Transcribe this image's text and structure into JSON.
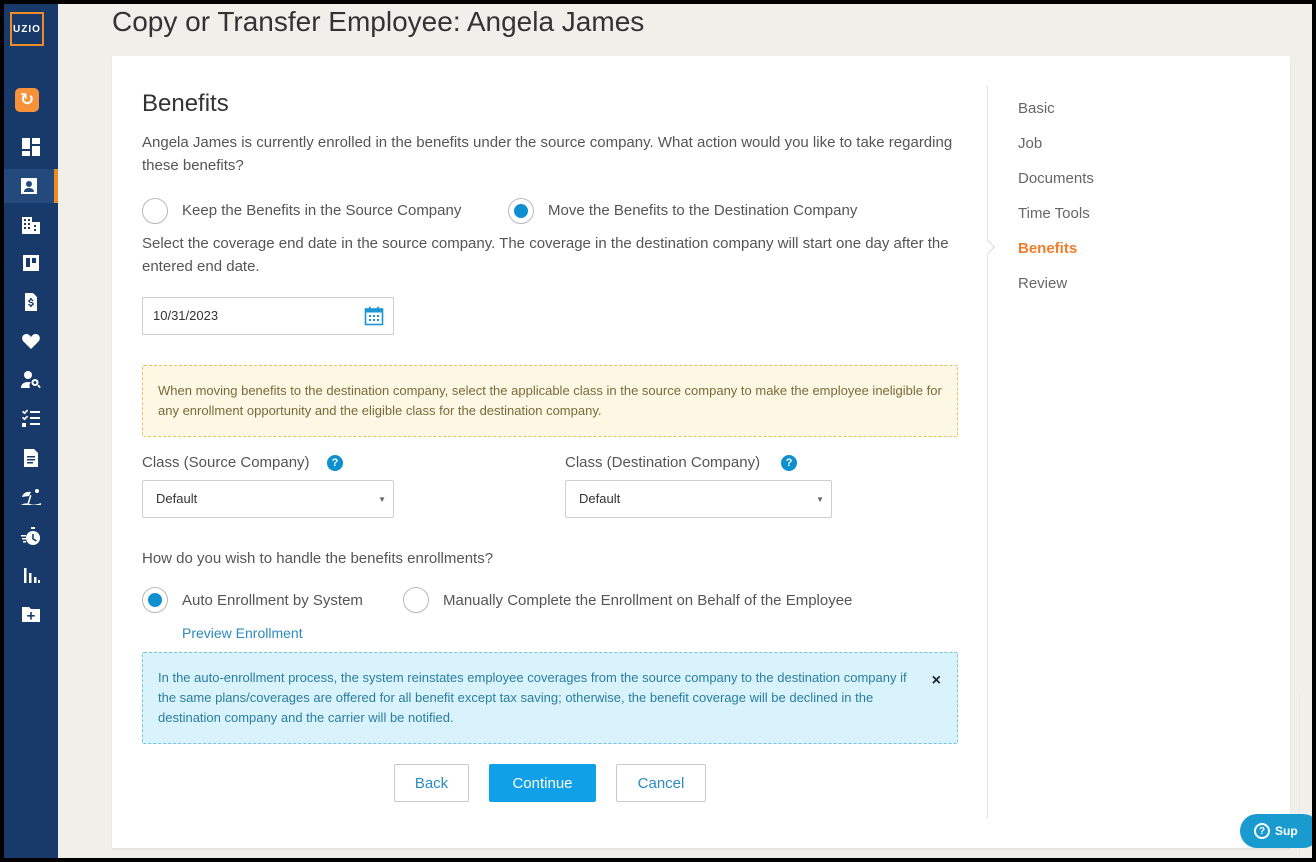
{
  "sidebar": {
    "logo": "UZIO",
    "items": [
      {
        "name": "dashboard-icon"
      },
      {
        "name": "employee-icon",
        "active": true
      },
      {
        "name": "company-building-icon"
      },
      {
        "name": "board-icon"
      },
      {
        "name": "payroll-document-icon"
      },
      {
        "name": "heart-icon"
      },
      {
        "name": "user-search-icon"
      },
      {
        "name": "checklist-icon"
      },
      {
        "name": "document-icon"
      },
      {
        "name": "beach-icon"
      },
      {
        "name": "timer-icon"
      },
      {
        "name": "reports-icon"
      },
      {
        "name": "add-folder-icon"
      }
    ]
  },
  "page": {
    "title": "Copy or Transfer Employee: Angela James"
  },
  "steps": [
    {
      "label": "Basic"
    },
    {
      "label": "Job"
    },
    {
      "label": "Documents"
    },
    {
      "label": "Time Tools"
    },
    {
      "label": "Benefits",
      "current": true
    },
    {
      "label": "Review"
    }
  ],
  "benefits": {
    "heading": "Benefits",
    "intro": "Angela James is currently enrolled in the benefits under the source company. What action would you like to take regarding these benefits?",
    "option_keep": "Keep the Benefits in the Source Company",
    "option_move": "Move the Benefits to the Destination Company",
    "selected_option": "move",
    "date_instruction": "Select the coverage end date in the source company. The coverage in the destination company will start one day after the entered end date.",
    "end_date": "10/31/2023",
    "class_note": "When moving benefits to the destination company, select the applicable class in the source company to make the employee ineligible for any enrollment opportunity and the eligible class for the destination company.",
    "source_class_label": "Class (Source Company)",
    "source_class_value": "Default",
    "dest_class_label": "Class (Destination Company)",
    "dest_class_value": "Default",
    "enroll_question": "How do you wish to handle the benefits enrollments?",
    "enroll_auto": "Auto Enrollment by System",
    "enroll_manual": "Manually Complete the Enrollment on Behalf of the Employee",
    "enroll_selected": "auto",
    "preview_link": "Preview Enrollment",
    "auto_note": "In the auto-enrollment process, the system reinstates employee coverages from the source company to the destination company if the same plans/coverages are offered for all benefit except tax saving; otherwise, the benefit coverage will be declined in the destination company and the carrier will be notified."
  },
  "buttons": {
    "back": "Back",
    "continue": "Continue",
    "cancel": "Cancel"
  },
  "support": {
    "label": "Sup"
  },
  "colors": {
    "sidebar_bg": "#173a6b",
    "accent_orange": "#f07d2b",
    "primary_blue": "#10a0e8"
  }
}
